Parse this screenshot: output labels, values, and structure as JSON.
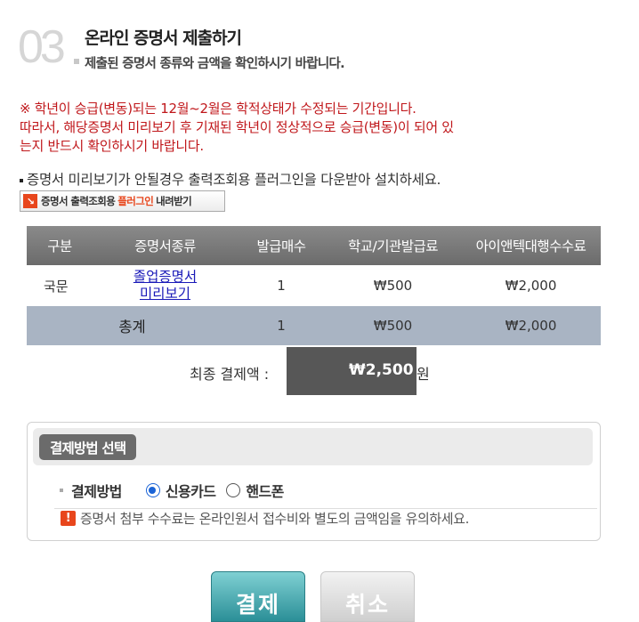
{
  "step": {
    "number": "03",
    "title": "온라인 증명서 제출하기",
    "subtitle": "제출된 증명서 종류와 금액을 확인하시기 바랍니다."
  },
  "notice": {
    "line1": "※ 학년이 승급(변동)되는 12월~2월은 학적상태가 수정되는 기간입니다.",
    "line2": "따라서, 해당증명서 미리보기 후 기재된 학년이 정상적으로 승급(변동)이 되어 있",
    "line3": "는지 반드시 확인하시기 바랍니다."
  },
  "plugin": {
    "message": "증명서 미리보기가 안될경우 출력조회용 플러그인을 다운받아 설치하세요.",
    "button_prefix": "증명서 출력조회용",
    "button_highlight": "플러그인",
    "button_suffix": "내려받기"
  },
  "table": {
    "headers": [
      "구분",
      "증명서종류",
      "발급매수",
      "학교/기관발급료",
      "아이앤텍대행수수료"
    ],
    "row": {
      "category": "국문",
      "cert_line1": "졸업증명서",
      "cert_line2": "미리보기",
      "count": "1",
      "school_fee": "₩500",
      "agency_fee": "₩2,000"
    },
    "total": {
      "label": "총계",
      "count": "1",
      "school_fee": "₩500",
      "agency_fee": "₩2,000"
    }
  },
  "final": {
    "label": "최종 결제액 :",
    "amount": "₩2,500",
    "unit": "원"
  },
  "payment": {
    "section_title": "결제방법 선택",
    "method_label": "결제방법",
    "options": [
      "신용카드",
      "핸드폰"
    ],
    "selected": "신용카드",
    "warning": "증명서 첨부 수수료는 온라인원서 접수비와 별도의 금액임을 유의하세요."
  },
  "buttons": {
    "pay": "결제",
    "cancel": "취소"
  },
  "colors": {
    "accent": "#2b8f97",
    "notice": "#c0171b",
    "total_row": "#a9b4c3"
  }
}
